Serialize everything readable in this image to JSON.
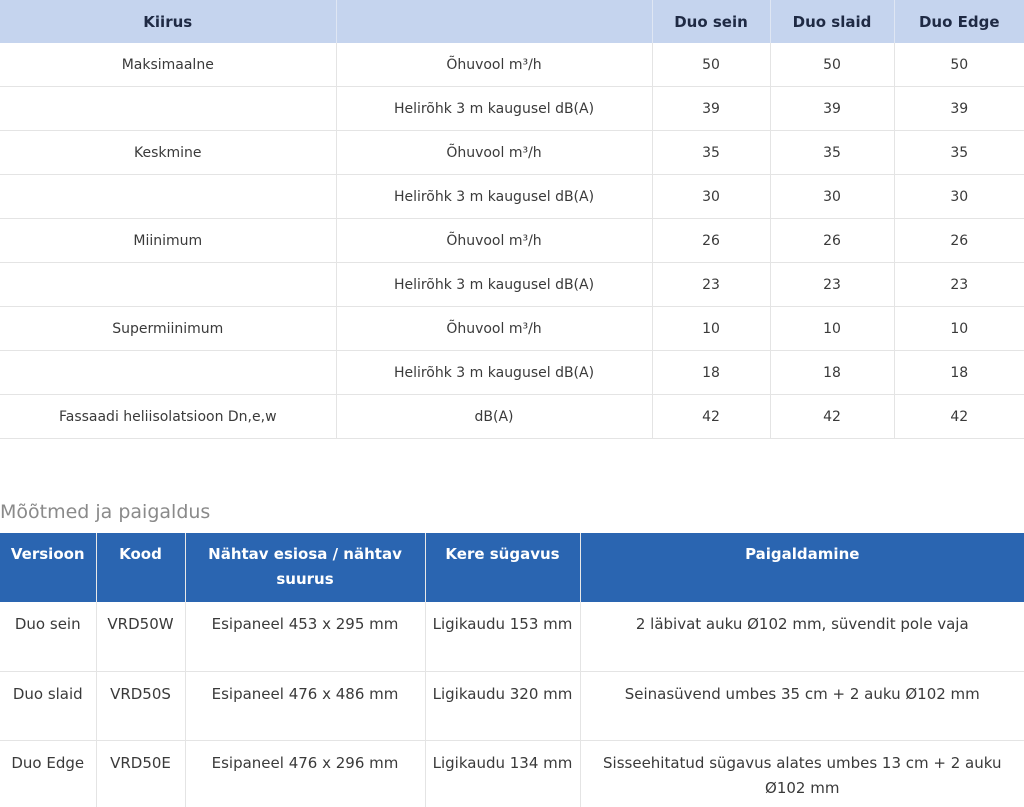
{
  "performance_table": {
    "headers": [
      "Kiirus",
      "",
      "Duo sein",
      "Duo slaid",
      "Duo Edge"
    ],
    "rows": [
      [
        "Maksimaalne",
        "Õhuvool m³/h",
        "50",
        "50",
        "50"
      ],
      [
        "",
        "Helirõhk 3 m kaugusel dB(A)",
        "39",
        "39",
        "39"
      ],
      [
        "Keskmine",
        "Õhuvool m³/h",
        "35",
        "35",
        "35"
      ],
      [
        "",
        "Helirõhk 3 m kaugusel dB(A)",
        "30",
        "30",
        "30"
      ],
      [
        "Miinimum",
        "Õhuvool m³/h",
        "26",
        "26",
        "26"
      ],
      [
        "",
        "Helirõhk 3 m kaugusel dB(A)",
        "23",
        "23",
        "23"
      ],
      [
        "Supermiinimum",
        "Õhuvool m³/h",
        "10",
        "10",
        "10"
      ],
      [
        "",
        "Helirõhk 3 m kaugusel dB(A)",
        "18",
        "18",
        "18"
      ],
      [
        "Fassaadi heliisolatsioon Dn,e,w",
        "dB(A)",
        "42",
        "42",
        "42"
      ]
    ]
  },
  "section_title": "Mõõtmed ja paigaldus",
  "dimensions_table": {
    "headers": [
      "Versioon",
      "Kood",
      "Nähtav esiosa / nähtav suurus",
      "Kere sügavus",
      "Paigaldamine"
    ],
    "rows": [
      [
        "Duo sein",
        "VRD50W",
        "Esipaneel 453 x 295 mm",
        "Ligikaudu 153 mm",
        "2 läbivat auku Ø102 mm, süvendit pole vaja"
      ],
      [
        "Duo slaid",
        "VRD50S",
        "Esipaneel 476 x 486 mm",
        "Ligikaudu 320 mm",
        "Seinasüvend umbes 35 cm + 2 auku Ø102 mm"
      ],
      [
        "Duo Edge",
        "VRD50E",
        "Esipaneel 476 x 296 mm",
        "Ligikaudu 134 mm",
        "Sisseehitatud sügavus alates umbes 13 cm + 2 auku Ø102 mm"
      ]
    ]
  },
  "colors": {
    "header_light": "#c5d4ee",
    "header_dark": "#2a65b1",
    "text": "#3a3a3a",
    "section_title": "#8a8a8a"
  }
}
